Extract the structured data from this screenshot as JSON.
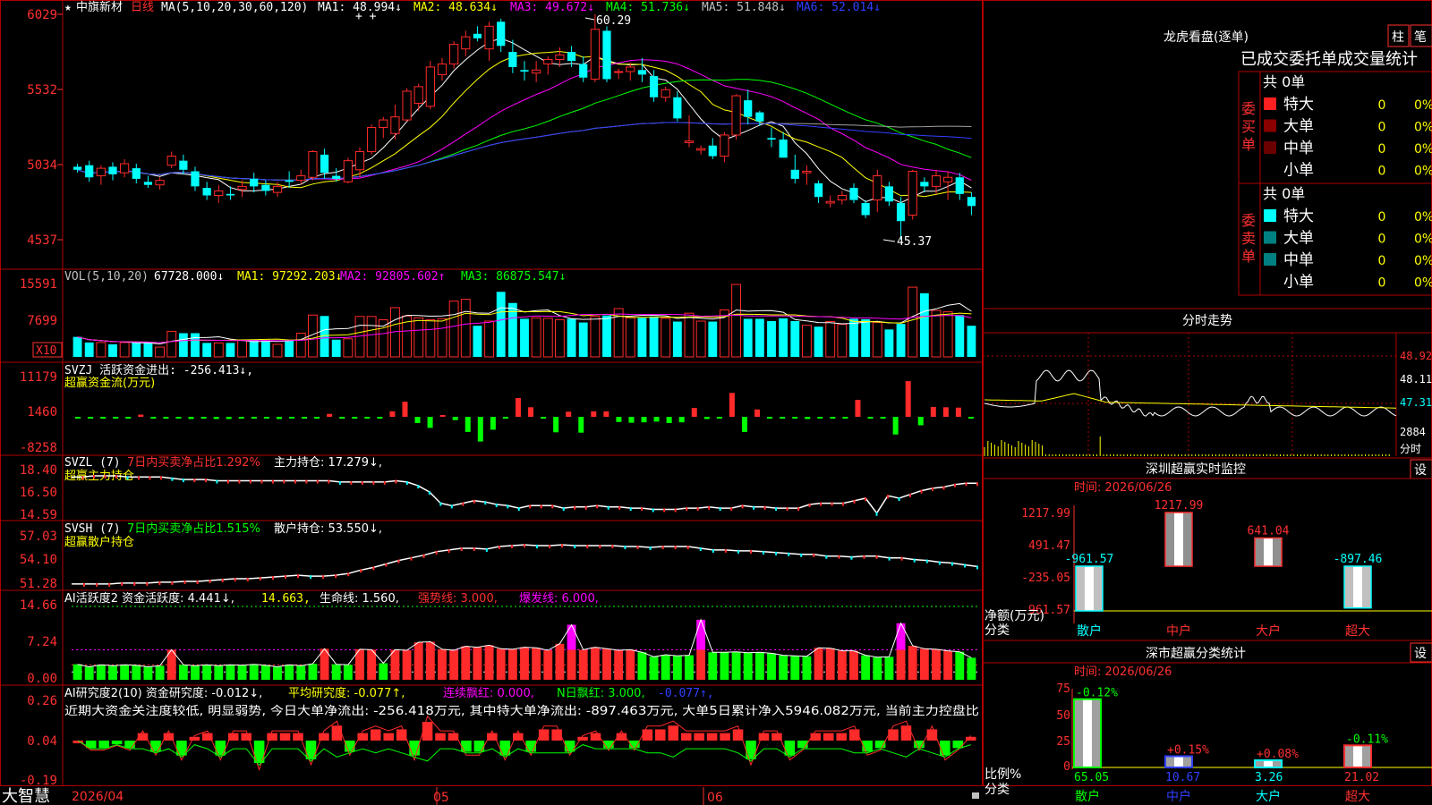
{
  "colors": {
    "up": "#ff2a2a",
    "down": "#00ffff",
    "ma1": "#ffffff",
    "ma2": "#ffff00",
    "ma3": "#ff00ff",
    "ma4": "#00ff00",
    "ma5": "#a0a0a0",
    "ma6": "#3040ff",
    "grid": "#b00000",
    "axis": "#ff3030",
    "bright_green": "#00ff00",
    "magenta": "#ff00ff",
    "yellow": "#ffff00",
    "white": "#ffffff"
  },
  "header": {
    "star": "★",
    "stock": "中旗新材",
    "period": "日线",
    "ma_label": "MA(5,10,20,30,60,120)",
    "ma1": "MA1: 48.994↓",
    "ma2": "MA2: 48.634↓",
    "ma3": "MA3: 49.672↓",
    "ma4": "MA4: 51.736↓",
    "ma5": "MA5: 51.848↓",
    "ma6": "MA6: 52.014↓",
    "high_note": "60.29",
    "low_note": "45.37"
  },
  "price_axis": [
    "6029",
    "5532",
    "5034",
    "4537"
  ],
  "vol": {
    "label": "VOL(5,10,20)",
    "v": "67728.000↓",
    "ma1": "MA1: 97292.203↓",
    "ma2": "MA2: 92805.602↑",
    "ma3": "MA3: 86875.547↓",
    "axis": [
      "15591",
      "7699"
    ],
    "unit": "X10"
  },
  "svzj": {
    "label": "SVZJ  活跃资金进出: -256.413↓,",
    "sub": "超赢资金流(万元)",
    "axis": [
      "11179",
      "1460",
      "-8258"
    ]
  },
  "svzl": {
    "label": "SVZL (7)",
    "red": "7日内买卖净占比1.292%",
    "main": "主力持仓: 17.279↓,",
    "sub": "超赢主力持仓",
    "axis": [
      "18.40",
      "16.50",
      "14.59"
    ]
  },
  "svsh": {
    "label": "SVSH (7)",
    "green": "7日内买卖净占比1.515%",
    "main": "散户持仓: 53.550↓,",
    "sub": "超赢散户持仓",
    "axis": [
      "57.03",
      "54.10",
      "51.28"
    ]
  },
  "ai1": {
    "label": "AI活跃度2 资金活跃度: 4.441↓,",
    "v2": "14.663,",
    "v3": "生命线: 1.560,",
    "v4": "强势线: 3.000,",
    "v5": "爆发线: 6.000,",
    "axis": [
      "14.66",
      "7.24",
      "0.00"
    ]
  },
  "ai2": {
    "label": "AI研究度2(10) 资金研究度: -0.012↓,",
    "v2": "平均研究度: -0.077↑,",
    "v3": "连续飘红: 0.000,",
    "v4": "N日飘红: 3.000,",
    "v5": "-0.077↑,",
    "text": "近期大资金关注度较低, 明显弱势, 今日大单净流出: -256.418万元, 其中特大单净流出: -897.463万元, 大单5日累计净入5946.082万元, 当前主力控盘比",
    "axis": [
      "0.26",
      "0.04",
      "-0.19"
    ]
  },
  "footer": {
    "brand": "大智慧",
    "date": "2026/04",
    "m1": "05",
    "m2": "06"
  },
  "lhb": {
    "title": "龙虎看盘(逐单)",
    "btn1": "柱",
    "btn2": "笔",
    "section": "已成交委托单成交量统计",
    "buy_label": "委买单",
    "sell_label": "委卖单",
    "buy_total": "共 0单",
    "sell_total": "共 0单",
    "buy_rows": [
      {
        "name": "特大",
        "n": "0",
        "p": "0%"
      },
      {
        "name": "大单",
        "n": "0",
        "p": "0%"
      },
      {
        "name": "中单",
        "n": "0",
        "p": "0%"
      },
      {
        "name": "小单",
        "n": "0",
        "p": "0%"
      }
    ],
    "sell_rows": [
      {
        "name": "特大",
        "n": "0",
        "p": "0%"
      },
      {
        "name": "大单",
        "n": "0",
        "p": "0%"
      },
      {
        "name": "中单",
        "n": "0",
        "p": "0%"
      },
      {
        "name": "小单",
        "n": "0",
        "p": "0%"
      }
    ]
  },
  "fenshi": {
    "title": "分时走势",
    "axis": [
      "48.92",
      "48.11",
      "47.31",
      "2884"
    ],
    "unit": "分时"
  },
  "sz_monitor": {
    "title": "深圳超赢实时监控",
    "btn": "设",
    "time": "时间: 2026/06/26",
    "axis": [
      "1217.99",
      "491.47",
      "-235.05",
      "-961.57"
    ],
    "ylabel": "净额(万元)",
    "xlabel": "分类",
    "bars": [
      {
        "name": "散户",
        "value": -961.57,
        "label": "-961.57"
      },
      {
        "name": "中户",
        "value": 1217.99,
        "label": "1217.99"
      },
      {
        "name": "大户",
        "value": 641.04,
        "label": "641.04"
      },
      {
        "name": "超大",
        "value": -897.46,
        "label": "-897.46"
      }
    ]
  },
  "sz_class": {
    "title": "深市超赢分类统计",
    "btn": "设",
    "time": "时间: 2026/06/26",
    "axis": [
      "75",
      "50",
      "25",
      "0"
    ],
    "ylabel": "比例%",
    "xlabel": "分类",
    "bars": [
      {
        "name": "散户",
        "value": 65.05,
        "pct": "-0.12%"
      },
      {
        "name": "中户",
        "value": 10.67,
        "pct": "+0.15%"
      },
      {
        "name": "大户",
        "value": 3.26,
        "pct": "+0.08%"
      },
      {
        "name": "超大",
        "value": 21.02,
        "pct": "-0.11%"
      }
    ]
  },
  "chart_data": [
    {
      "type": "candlestick",
      "title": "中旗新材 日线",
      "ylim": [
        45.37,
        60.29
      ],
      "ohlc": [
        [
          50.2,
          50.4,
          49.8,
          50.0
        ],
        [
          50.3,
          50.6,
          49.2,
          49.5
        ],
        [
          49.6,
          50.3,
          49.0,
          50.1
        ],
        [
          50.2,
          50.5,
          49.3,
          49.7
        ],
        [
          49.8,
          50.7,
          49.5,
          50.4
        ],
        [
          50.1,
          50.4,
          49.1,
          49.4
        ],
        [
          49.2,
          49.6,
          48.8,
          49.0
        ],
        [
          49.0,
          49.5,
          48.7,
          49.3
        ],
        [
          50.3,
          51.2,
          50.1,
          50.9
        ],
        [
          50.6,
          51.0,
          49.7,
          50.0
        ],
        [
          49.9,
          50.2,
          48.6,
          48.9
        ],
        [
          48.8,
          49.2,
          48.0,
          48.3
        ],
        [
          48.3,
          49.0,
          47.8,
          48.6
        ],
        [
          48.4,
          48.9,
          48.0,
          48.3
        ],
        [
          48.7,
          49.3,
          48.2,
          48.9
        ],
        [
          49.4,
          49.8,
          48.5,
          48.9
        ],
        [
          49.0,
          49.3,
          48.3,
          48.6
        ],
        [
          48.5,
          49.2,
          48.2,
          48.9
        ],
        [
          49.3,
          49.9,
          48.8,
          49.2
        ],
        [
          49.3,
          50.0,
          49.0,
          49.6
        ],
        [
          49.5,
          51.3,
          49.3,
          51.2
        ],
        [
          51.0,
          51.4,
          49.4,
          49.8
        ],
        [
          49.6,
          50.1,
          49.2,
          49.4
        ],
        [
          49.2,
          50.8,
          49.1,
          50.6
        ],
        [
          50.0,
          51.5,
          49.5,
          51.2
        ],
        [
          51.2,
          53.0,
          51.0,
          52.8
        ],
        [
          52.8,
          53.5,
          52.1,
          53.3
        ],
        [
          52.4,
          54.3,
          52.0,
          53.5
        ],
        [
          53.3,
          55.4,
          53.2,
          55.2
        ],
        [
          54.4,
          55.7,
          53.9,
          55.5
        ],
        [
          54.2,
          57.2,
          54.0,
          56.8
        ],
        [
          56.3,
          57.4,
          55.9,
          57.0
        ],
        [
          57.0,
          58.5,
          56.7,
          58.3
        ],
        [
          58.0,
          59.2,
          57.5,
          58.8
        ],
        [
          59.0,
          59.5,
          58.5,
          58.7
        ],
        [
          58.0,
          59.8,
          57.2,
          59.5
        ],
        [
          59.8,
          60.0,
          57.8,
          58.2
        ],
        [
          57.8,
          58.6,
          56.4,
          56.8
        ],
        [
          56.6,
          57.2,
          55.9,
          56.5
        ],
        [
          56.4,
          57.2,
          55.8,
          56.6
        ],
        [
          57.0,
          57.5,
          56.3,
          57.3
        ],
        [
          57.3,
          58.1,
          56.8,
          57.6
        ],
        [
          57.8,
          58.2,
          56.8,
          57.2
        ],
        [
          57.0,
          57.5,
          55.8,
          56.1
        ],
        [
          56.0,
          60.29,
          55.8,
          59.3
        ],
        [
          59.2,
          59.5,
          55.8,
          56.0
        ],
        [
          56.5,
          56.7,
          56.0,
          56.5
        ],
        [
          56.5,
          57.1,
          55.9,
          56.8
        ],
        [
          56.6,
          57.4,
          55.8,
          56.3
        ],
        [
          56.2,
          56.6,
          54.5,
          54.8
        ],
        [
          54.8,
          55.5,
          54.5,
          55.3
        ],
        [
          54.8,
          55.2,
          53.2,
          53.4
        ],
        [
          51.8,
          53.6,
          51.5,
          51.9
        ],
        [
          51.3,
          51.6,
          51.0,
          51.4
        ],
        [
          51.6,
          52.1,
          50.7,
          50.9
        ],
        [
          50.9,
          52.5,
          50.5,
          52.3
        ],
        [
          52.3,
          55.0,
          52.0,
          54.9
        ],
        [
          54.6,
          55.3,
          53.0,
          53.5
        ],
        [
          53.8,
          53.9,
          52.9,
          53.2
        ],
        [
          52.1,
          52.8,
          51.5,
          52.0
        ],
        [
          52.0,
          52.5,
          50.8,
          50.8
        ],
        [
          50.0,
          51.0,
          49.1,
          49.4
        ],
        [
          49.8,
          50.3,
          49.0,
          49.9
        ],
        [
          49.1,
          49.3,
          47.8,
          48.2
        ],
        [
          47.8,
          48.3,
          47.5,
          47.9
        ],
        [
          48.0,
          48.6,
          47.7,
          48.3
        ],
        [
          48.8,
          49.1,
          47.8,
          48.0
        ],
        [
          47.8,
          48.0,
          46.8,
          47.0
        ],
        [
          48.0,
          50.0,
          47.2,
          49.6
        ],
        [
          48.9,
          49.2,
          47.6,
          47.9
        ],
        [
          47.8,
          48.2,
          45.37,
          46.6
        ],
        [
          47.0,
          50.0,
          46.7,
          49.9
        ],
        [
          49.2,
          49.5,
          48.5,
          48.9
        ],
        [
          48.9,
          50.0,
          48.4,
          49.6
        ],
        [
          49.2,
          49.9,
          48.0,
          49.5
        ],
        [
          49.5,
          49.8,
          48.0,
          48.4
        ],
        [
          48.2,
          48.5,
          47.0,
          47.6
        ]
      ]
    },
    {
      "type": "bar",
      "title": "VOL(5,10,20)",
      "values": [
        4300,
        3100,
        3100,
        2700,
        3100,
        3100,
        3000,
        2100,
        5500,
        5100,
        5100,
        3000,
        3000,
        3000,
        3600,
        3700,
        3600,
        2700,
        3600,
        5100,
        9000,
        8800,
        3700,
        3900,
        8700,
        8700,
        8000,
        10600,
        8800,
        8400,
        8000,
        8200,
        12000,
        12400,
        6700,
        7700,
        14000,
        11600,
        8200,
        8400,
        8300,
        8000,
        8200,
        7400,
        8700,
        8900,
        10400,
        8400,
        8400,
        8700,
        8300,
        7600,
        9400,
        7700,
        7600,
        10100,
        15591,
        8200,
        8200,
        7700,
        8300,
        7700,
        6800,
        6500,
        7600,
        7000,
        8200,
        8100,
        7400,
        5900,
        7100,
        15000,
        13700,
        10000,
        9700,
        9000,
        6700
      ]
    },
    {
      "type": "bar",
      "title": "SVZJ 活跃资金进出",
      "ylim": [
        -8258,
        11179
      ],
      "values": [
        -400,
        -500,
        -500,
        -500,
        -500,
        600,
        -400,
        -500,
        -400,
        -600,
        -500,
        -600,
        -600,
        -500,
        -500,
        -400,
        -600,
        -400,
        -500,
        -500,
        800,
        -500,
        -500,
        -400,
        -500,
        1500,
        4100,
        -1700,
        -3000,
        500,
        -900,
        -4100,
        -6700,
        -3500,
        -400,
        5100,
        2600,
        -500,
        -4200,
        1400,
        -4300,
        1500,
        1500,
        -1400,
        -1600,
        -1500,
        -1300,
        -1700,
        -1500,
        2400,
        -600,
        -400,
        6500,
        -4100,
        2000,
        -500,
        -500,
        -400,
        -600,
        -300,
        -500,
        -500,
        4600,
        -500,
        -500,
        -4800,
        9700,
        -2300,
        2700,
        2600,
        2500,
        -500
      ]
    },
    {
      "type": "line",
      "title": "SVZL 主力持仓",
      "ylim": [
        14.59,
        18.4
      ],
      "values": [
        17.8,
        17.8,
        17.9,
        17.9,
        17.9,
        17.8,
        17.8,
        17.8,
        17.8,
        17.7,
        17.6,
        17.6,
        17.6,
        17.5,
        17.5,
        17.5,
        17.5,
        17.5,
        17.5,
        17.5,
        17.5,
        17.5,
        17.5,
        17.5,
        17.4,
        17.4,
        17.4,
        17.4,
        17.4,
        17.5,
        17.4,
        17.1,
        16.6,
        15.7,
        15.5,
        15.7,
        15.9,
        15.8,
        15.6,
        15.5,
        15.3,
        15.5,
        15.5,
        15.5,
        15.3,
        15.4,
        15.4,
        15.5,
        15.4,
        15.4,
        15.3,
        15.3,
        15.2,
        15.2,
        15.2,
        15.3,
        15.3,
        15.4,
        15.3,
        15.3,
        15.5,
        15.4,
        15.4,
        15.3,
        15.3,
        15.3,
        15.6,
        15.7,
        15.7,
        15.7,
        15.9,
        16.1,
        14.9,
        16.3,
        16.1,
        16.4,
        16.7,
        16.9,
        17.0,
        17.2,
        17.3,
        17.3
      ]
    },
    {
      "type": "line",
      "title": "SVSH 散户持仓",
      "ylim": [
        51.28,
        57.03
      ],
      "values": [
        51.6,
        51.6,
        51.6,
        51.6,
        51.7,
        51.7,
        51.7,
        51.8,
        51.8,
        51.9,
        51.9,
        52.0,
        52.1,
        52.2,
        52.2,
        52.3,
        52.4,
        52.5,
        52.6,
        52.5,
        52.5,
        52.6,
        52.8,
        53.2,
        53.5,
        53.9,
        54.3,
        54.6,
        54.9,
        55.3,
        55.5,
        55.7,
        55.7,
        55.6,
        55.9,
        56.0,
        56.1,
        56.0,
        56.0,
        56.1,
        56.0,
        56.0,
        56.0,
        56.0,
        55.9,
        55.9,
        55.8,
        55.9,
        55.9,
        55.9,
        55.7,
        55.5,
        55.5,
        55.4,
        55.4,
        55.3,
        55.2,
        55.1,
        55.0,
        55.0,
        54.8,
        54.8,
        54.7,
        54.8,
        54.8,
        54.6,
        54.6,
        54.4,
        54.3,
        54.1,
        54.0,
        53.8,
        53.6
      ]
    },
    {
      "type": "bar",
      "title": "AI活跃度2",
      "ylim": [
        0,
        14.66
      ],
      "values": [
        3.1,
        2.6,
        3.0,
        2.8,
        3.0,
        2.9,
        2.6,
        2.8,
        6.0,
        3.0,
        2.8,
        3.0,
        2.8,
        3.0,
        2.9,
        3.1,
        2.9,
        2.6,
        3.0,
        2.8,
        3.2,
        6.2,
        3.1,
        3.0,
        6.1,
        6.0,
        3.3,
        6.0,
        5.9,
        7.5,
        7.6,
        6.1,
        5.9,
        6.7,
        6.5,
        6.9,
        6.2,
        6.1,
        6.5,
        6.4,
        5.9,
        7.2,
        11.0,
        6.0,
        6.5,
        6.2,
        5.9,
        6.0,
        5.5,
        4.6,
        5.0,
        4.8,
        4.9,
        12.0,
        5.5,
        5.5,
        5.6,
        5.4,
        5.5,
        5.3,
        4.9,
        4.8,
        4.7,
        6.4,
        6.3,
        5.8,
        5.8,
        4.9,
        4.5,
        4.6,
        11.3,
        6.8,
        6.2,
        6.1,
        5.8,
        5.6,
        4.4
      ]
    },
    {
      "type": "bar",
      "title": "AI研究度2(10)",
      "ylim": [
        -0.19,
        0.26
      ],
      "values": [
        0,
        -0.02,
        -0.02,
        -0.01,
        -0.02,
        0.02,
        -0.03,
        0.02,
        -0.04,
        0.01,
        0.02,
        -0.04,
        0.02,
        0.02,
        -0.06,
        0.02,
        0.02,
        0.02,
        -0.05,
        0.02,
        0.04,
        -0.03,
        0.02,
        0.03,
        0.02,
        0.03,
        -0.04,
        0.05,
        0.02,
        0.02,
        -0.03,
        -0.03,
        0.02,
        -0.04,
        0.02,
        -0.03,
        0.03,
        0.03,
        -0.03,
        0.01,
        0.02,
        -0.02,
        0.02,
        -0.02,
        0.03,
        0.03,
        0.04,
        0.02,
        0.02,
        0.02,
        0.02,
        0.03,
        -0.05,
        0.02,
        0.02,
        -0.04,
        -0.02,
        0.02,
        0.02,
        0.02,
        0.03,
        -0.03,
        -0.02,
        0.03,
        0.04,
        -0.02,
        0.03,
        -0.04,
        -0.02,
        0.01
      ]
    }
  ]
}
